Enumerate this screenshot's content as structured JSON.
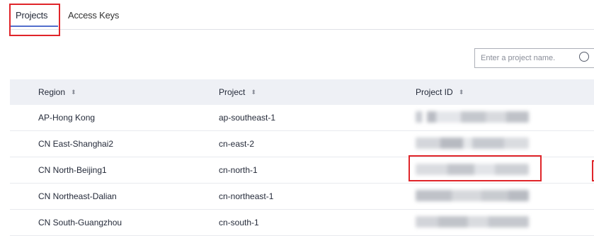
{
  "tabs": [
    {
      "label": "Projects",
      "active": true
    },
    {
      "label": "Access Keys",
      "active": false
    }
  ],
  "search": {
    "placeholder": "Enter a project name.",
    "value": "",
    "icon": "search-icon"
  },
  "table": {
    "columns": [
      "Region",
      "Project",
      "Project ID"
    ],
    "sort_icon": "⬍",
    "rows": [
      {
        "region": "AP-Hong Kong",
        "project": "ap-southeast-1"
      },
      {
        "region": "CN East-Shanghai2",
        "project": "cn-east-2"
      },
      {
        "region": "CN North-Beijing1",
        "project": "cn-north-1"
      },
      {
        "region": "CN Northeast-Dalian",
        "project": "cn-northeast-1"
      },
      {
        "region": "CN South-Guangzhou",
        "project": "cn-south-1"
      }
    ]
  },
  "colors": {
    "accent": "#526ecc",
    "highlight": "#e0252a",
    "header_bg": "#eef0f5"
  }
}
